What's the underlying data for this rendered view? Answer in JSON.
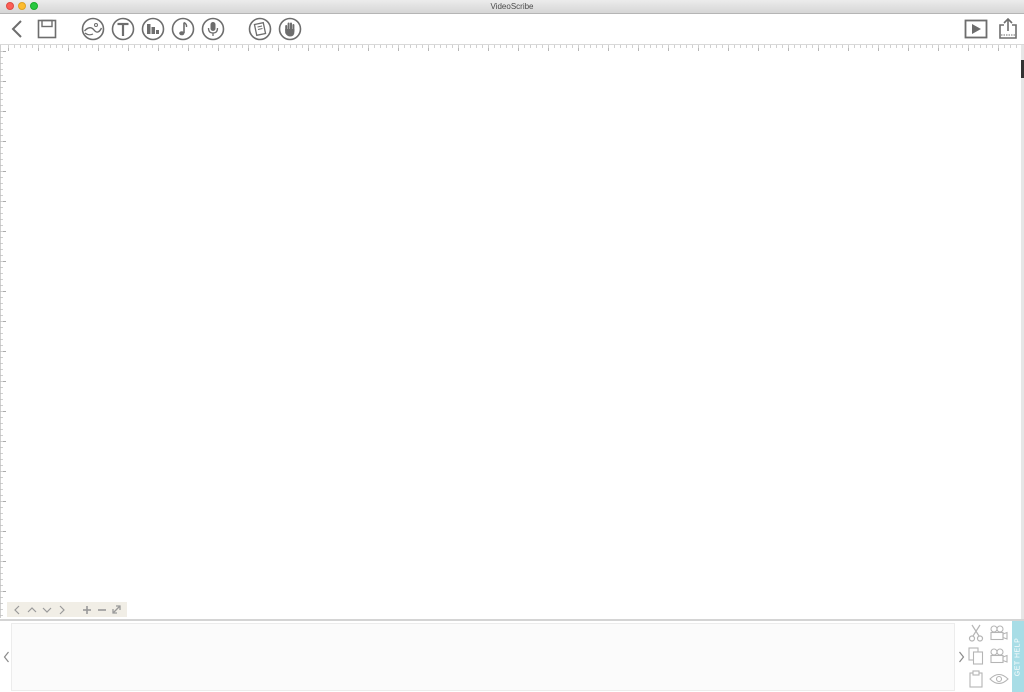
{
  "window": {
    "title": "VideoScribe"
  },
  "toolbar": {
    "left": [
      {
        "name": "back-icon"
      },
      {
        "name": "save-icon"
      }
    ],
    "tools": [
      {
        "name": "add-image-icon"
      },
      {
        "name": "add-text-icon"
      },
      {
        "name": "add-chart-icon"
      },
      {
        "name": "music-icon"
      },
      {
        "name": "voiceover-icon"
      },
      {
        "name": "background-icon"
      },
      {
        "name": "hand-icon"
      }
    ],
    "right": [
      {
        "name": "play-icon"
      },
      {
        "name": "export-icon"
      }
    ]
  },
  "canvas_nav": {
    "icons": [
      "chevron-left-icon",
      "chevron-up-icon",
      "chevron-down-icon",
      "chevron-right-icon",
      "zoom-in-icon",
      "zoom-out-icon",
      "fit-screen-icon"
    ]
  },
  "timeline": {
    "edit_icons": [
      "cut-icon",
      "camera-set-icon",
      "copy-icon",
      "camera-get-icon",
      "paste-icon",
      "preview-eye-icon"
    ]
  },
  "help": {
    "label": "GET HELP",
    "color": "#a8dde6"
  }
}
